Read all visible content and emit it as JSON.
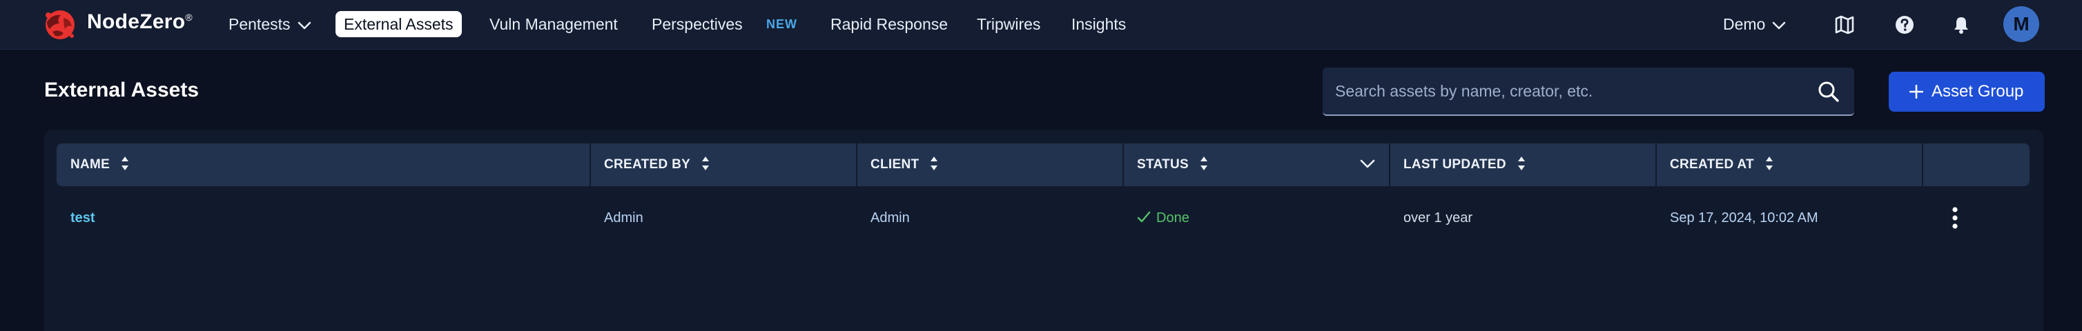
{
  "brand": {
    "name": "NodeZero",
    "mark": "®"
  },
  "nav": {
    "items": [
      {
        "label": "Pentests"
      },
      {
        "label": "External Assets"
      },
      {
        "label": "Vuln Management"
      },
      {
        "label": "Perspectives"
      },
      {
        "label": "Rapid Response"
      },
      {
        "label": "Tripwires"
      },
      {
        "label": "Insights"
      }
    ],
    "new_badge": "NEW",
    "account_label": "Demo",
    "avatar_initial": "M"
  },
  "page": {
    "title": "External Assets"
  },
  "search": {
    "placeholder": "Search assets by name, creator, etc."
  },
  "actions": {
    "add_asset_group": "Asset Group"
  },
  "table": {
    "columns": [
      {
        "label": "NAME"
      },
      {
        "label": "CREATED BY"
      },
      {
        "label": "CLIENT"
      },
      {
        "label": "STATUS"
      },
      {
        "label": "LAST UPDATED"
      },
      {
        "label": "CREATED AT"
      }
    ],
    "rows": [
      {
        "name": "test",
        "created_by": "Admin",
        "client": "Admin",
        "status": "Done",
        "last_updated": "over 1 year",
        "created_at": "Sep 17, 2024, 10:02 AM"
      }
    ]
  },
  "colors": {
    "background": "#0b1120",
    "nav": "#141d31",
    "accent": "#1e4fd6",
    "link": "#5ec8f0",
    "success": "#58c26a",
    "logo_red": "#e8322f"
  }
}
